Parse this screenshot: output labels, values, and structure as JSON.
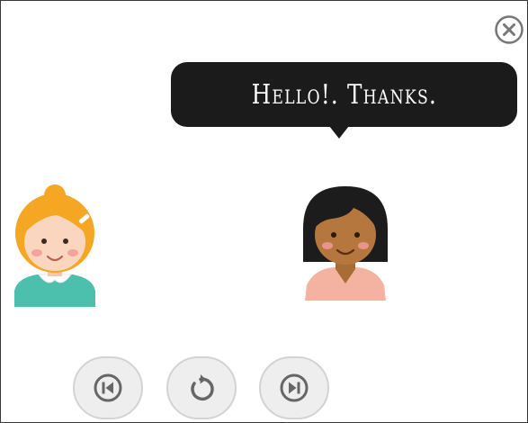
{
  "dialogue": {
    "speech_text": "Hello!. Thanks."
  },
  "controls": {
    "previous_icon": "skip-previous-icon",
    "replay_icon": "replay-icon",
    "next_icon": "skip-next-icon",
    "close_icon": "close-icon"
  },
  "colors": {
    "bubble": "#1b1b1b",
    "bubble_text": "#ffffff",
    "button_fill": "#eeeeee",
    "button_border": "#d3d3d3",
    "icon": "#666666",
    "left_hair": "#f5a623",
    "left_shirt": "#4dbfad",
    "right_hair": "#1c1c1c",
    "right_skin": "#b5773e",
    "right_shirt": "#f3b3a0"
  }
}
